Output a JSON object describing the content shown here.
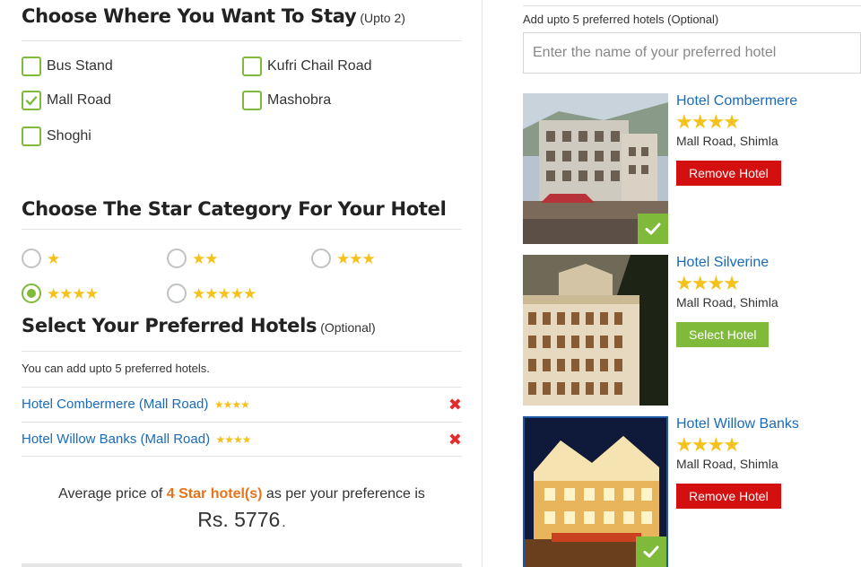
{
  "stay": {
    "title": "Choose Where You Want To Stay",
    "note": "(Upto 2)",
    "options": [
      {
        "label": "Bus Stand",
        "checked": false
      },
      {
        "label": "Kufri Chail Road",
        "checked": false
      },
      {
        "label": "Mall Road",
        "checked": true
      },
      {
        "label": "Mashobra",
        "checked": false
      },
      {
        "label": "Shoghi",
        "checked": false
      }
    ]
  },
  "stars": {
    "title": "Choose The Star Category For Your Hotel",
    "options": [
      {
        "stars": "★",
        "selected": false
      },
      {
        "stars": "★★",
        "selected": false
      },
      {
        "stars": "★★★",
        "selected": false
      },
      {
        "stars": "★★★★",
        "selected": true
      },
      {
        "stars": "★★★★★",
        "selected": false
      }
    ]
  },
  "preferred": {
    "title": "Select Your Preferred Hotels",
    "note": "(Optional)",
    "hint": "You can add upto 5 preferred hotels.",
    "items": [
      {
        "name": "Hotel Combermere (Mall Road)",
        "stars": "★★★★"
      },
      {
        "name": "Hotel Willow Banks (Mall Road)",
        "stars": "★★★★"
      }
    ],
    "remove_icon": "✖"
  },
  "average": {
    "prefix": "Average price of ",
    "category": "4 Star hotel(s)",
    "suffix": " as per your preference is",
    "price": "Rs. 5776",
    "price_dot": "."
  },
  "search": {
    "label": "Add upto 5 preferred hotels (Optional)",
    "placeholder": "Enter the name of your preferred hotel"
  },
  "hotels": [
    {
      "name": "Hotel Combermere",
      "stars": "★★★★",
      "location": "Mall Road, Shimla",
      "button": "Remove Hotel",
      "selected": true
    },
    {
      "name": "Hotel Silverine",
      "stars": "★★★★",
      "location": "Mall Road, Shimla",
      "button": "Select Hotel",
      "selected": false
    },
    {
      "name": "Hotel Willow Banks",
      "stars": "★★★★",
      "location": "Mall Road, Shimla",
      "button": "Remove Hotel",
      "selected": true
    }
  ],
  "colors": {
    "accent_green": "#7fba3a",
    "remove_red": "#d40f10",
    "link_blue": "#1a6bb8",
    "star_yellow": "#f5c21b",
    "highlight_orange": "#e8731a"
  },
  "icons": {
    "check": "check-icon",
    "remove": "remove-icon",
    "star": "star-icon"
  }
}
